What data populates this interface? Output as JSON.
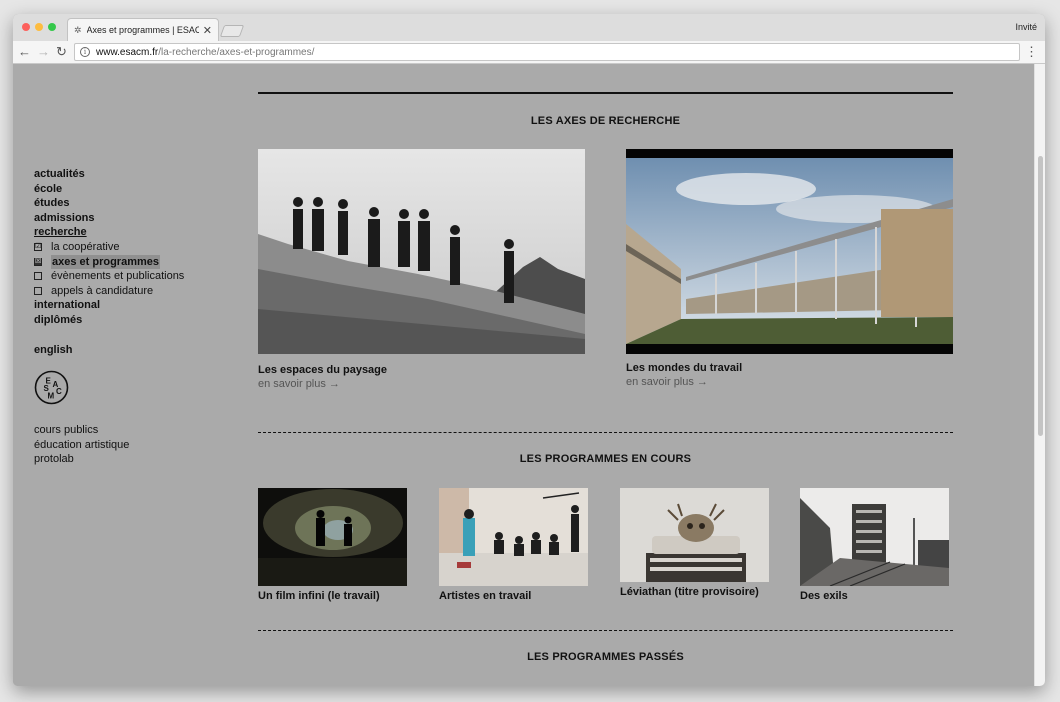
{
  "browser": {
    "tab_title": "Axes et programmes | ESACM",
    "tab_close": "✕",
    "guest_label": "Invité",
    "url_host": "www.esacm.fr",
    "url_path": "/la-recherche/axes-et-programmes/"
  },
  "nav": {
    "main1": [
      "actualités",
      "école",
      "études",
      "admissions",
      "recherche"
    ],
    "sub": [
      {
        "label": "la coopérative",
        "mark": "☑"
      },
      {
        "label": "axes et programmes",
        "mark": "☒"
      },
      {
        "label": "évènements et publications",
        "mark": ""
      },
      {
        "label": "appels à candidature",
        "mark": ""
      }
    ],
    "main2": [
      "international",
      "diplômés"
    ],
    "english": "english",
    "logo_letters": [
      "E",
      "S",
      "A",
      "C",
      "M"
    ],
    "extra": [
      "cours publics",
      "éducation artistique",
      "protolab"
    ]
  },
  "axes": {
    "heading": "LES AXES DE RECHERCHE",
    "items": [
      {
        "title": "Les espaces du paysage",
        "link": "en savoir plus →"
      },
      {
        "title": "Les mondes du travail",
        "link": "en savoir plus →"
      }
    ]
  },
  "programmes_en_cours": {
    "heading": "LES PROGRAMMES EN COURS",
    "items": [
      {
        "title": "Un film infini (le travail)"
      },
      {
        "title": "Artistes en travail"
      },
      {
        "title": "Léviathan (titre provisoire)"
      },
      {
        "title": "Des exils"
      }
    ]
  },
  "programmes_passes": {
    "heading": "LES PROGRAMMES PASSÉS"
  },
  "colors": {
    "page_background": "#aaaaaa",
    "text": "#111111"
  }
}
